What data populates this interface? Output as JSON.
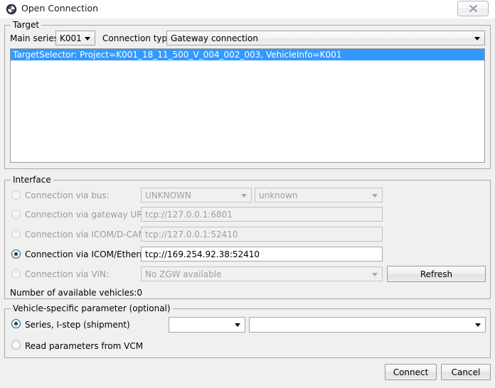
{
  "window": {
    "title": "Open Connection",
    "app_icon": "bmw-roundel-icon",
    "close_button_glyph": "✕"
  },
  "target": {
    "group_title": "Target",
    "main_series_label": "Main series:",
    "main_series_value": "K001",
    "connection_type_label": "Connection type:",
    "connection_type_value": "Gateway connection",
    "list_items": [
      "TargetSelector: Project=K001_18_11_500_V_004_002_003, VehicleInfo=K001"
    ]
  },
  "interface": {
    "group_title": "Interface",
    "rows": [
      {
        "label": "Connection via bus:",
        "selected": false,
        "disabled": true,
        "combo1": "UNKNOWN",
        "combo2": "unknown"
      },
      {
        "label": "Connection via gateway URL:",
        "selected": false,
        "disabled": true,
        "value": "tcp://127.0.0.1:6801"
      },
      {
        "label": "Connection via ICOM/D-CAN:",
        "selected": false,
        "disabled": true,
        "value": "tcp://127.0.0.1:52410"
      },
      {
        "label": "Connection via ICOM/Ethernet:",
        "selected": true,
        "disabled": false,
        "value": "tcp://169.254.92.38:52410"
      },
      {
        "label": "Connection via VIN:",
        "selected": false,
        "disabled": true,
        "value": "No ZGW available"
      }
    ],
    "refresh_button": "Refresh",
    "status_text": "Number of available vehicles:0"
  },
  "vehicle_params": {
    "group_title": "Vehicle-specific parameter (optional)",
    "options": [
      {
        "label": "Series, I-step (shipment)",
        "selected": true
      },
      {
        "label": "Read parameters from VCM",
        "selected": false
      }
    ],
    "series_combo_value": "",
    "istep_combo_value": ""
  },
  "footer": {
    "connect_button": "Connect",
    "cancel_button": "Cancel"
  },
  "colors": {
    "selection_blue": "#3399ff",
    "dialog_bg": "#f0f0f0",
    "border": "#a8a8a8",
    "radio_checked": "#1d4355"
  }
}
